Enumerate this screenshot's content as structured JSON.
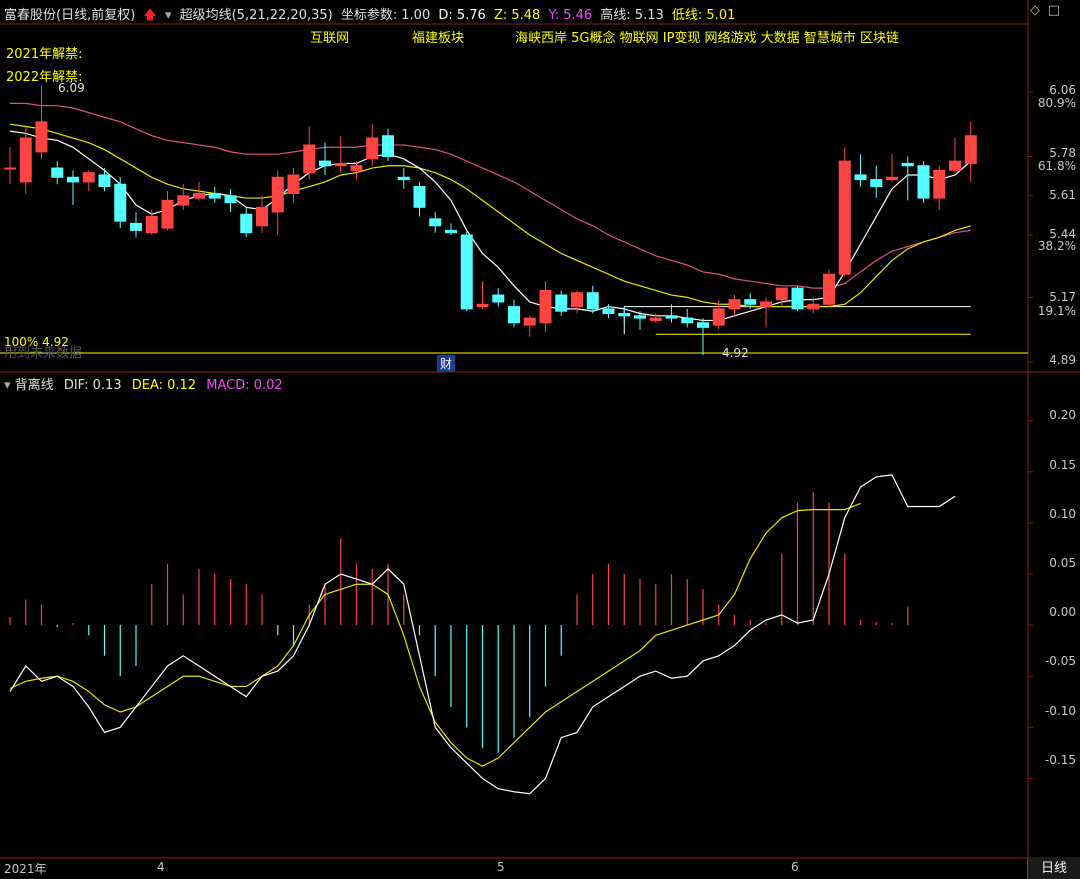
{
  "header": {
    "stock_name": "富春股份(日线,前复权)",
    "indicator_name": "超级均线(5,21,22,20,35)",
    "coord_label": "坐标参数:",
    "coord_value": "1.00",
    "d_text": "D: 5.76",
    "z_text": "Z: 5.48",
    "y_text": "Y: 5.46",
    "high_text": "高线: 5.13",
    "low_text": "低线: 5.01",
    "colors": {
      "d": "#ffffff",
      "z": "#ffff00",
      "y": "#ff44ff",
      "hl": "#ffff00"
    }
  },
  "concepts": {
    "c1": "互联网",
    "c2": "福建板块",
    "c3": "海峡西岸 5G概念 物联网 IP变现 网络游戏 大数据 智慧城市 区块链"
  },
  "unlock": {
    "u2021": "2021年解禁:",
    "u2022": "2022年解禁:"
  },
  "annotations": {
    "max_price": "6.09",
    "min_price": "4.92",
    "pct_label": "100% 4.92",
    "ghost_label": "用到未来数据",
    "finance_tag": "财"
  },
  "price_axis": {
    "ticks": [
      "6.06",
      "80.9%",
      "5.78",
      "61.8%",
      "5.61",
      "5.44",
      "38.2%",
      "5.17",
      "19.1%",
      "4.89"
    ]
  },
  "macd_header": {
    "name": "背离线",
    "dif": "DIF: 0.13",
    "dea": "DEA: 0.12",
    "macd": "MACD: 0.02"
  },
  "macd_axis": {
    "ticks": [
      "0.20",
      "0.15",
      "0.10",
      "0.05",
      "0.00",
      "-0.05",
      "-0.10",
      "-0.15"
    ]
  },
  "x_axis": {
    "labels": [
      "2021年",
      "4",
      "5",
      "6"
    ]
  },
  "period_button": "日线",
  "icons": [
    "arrow-up-icon",
    "diamond-icon",
    "window-icon",
    "collapse-icon"
  ],
  "chart_data": [
    {
      "type": "candlestick",
      "title": "富春股份(日线,前复权)",
      "ylim": [
        4.89,
        6.12
      ],
      "candles": [
        {
          "o": 5.73,
          "h": 5.82,
          "l": 5.66,
          "c": 5.73
        },
        {
          "o": 5.67,
          "h": 5.91,
          "l": 5.62,
          "c": 5.86
        },
        {
          "o": 5.8,
          "h": 6.09,
          "l": 5.77,
          "c": 5.93
        },
        {
          "o": 5.73,
          "h": 5.76,
          "l": 5.66,
          "c": 5.69
        },
        {
          "o": 5.69,
          "h": 5.72,
          "l": 5.57,
          "c": 5.67
        },
        {
          "o": 5.67,
          "h": 5.72,
          "l": 5.63,
          "c": 5.71
        },
        {
          "o": 5.7,
          "h": 5.73,
          "l": 5.63,
          "c": 5.65
        },
        {
          "o": 5.66,
          "h": 5.69,
          "l": 5.47,
          "c": 5.5
        },
        {
          "o": 5.49,
          "h": 5.54,
          "l": 5.43,
          "c": 5.46
        },
        {
          "o": 5.45,
          "h": 5.55,
          "l": 5.44,
          "c": 5.52
        },
        {
          "o": 5.47,
          "h": 5.63,
          "l": 5.46,
          "c": 5.59
        },
        {
          "o": 5.57,
          "h": 5.66,
          "l": 5.55,
          "c": 5.61
        },
        {
          "o": 5.6,
          "h": 5.67,
          "l": 5.59,
          "c": 5.62
        },
        {
          "o": 5.62,
          "h": 5.65,
          "l": 5.58,
          "c": 5.6
        },
        {
          "o": 5.61,
          "h": 5.64,
          "l": 5.54,
          "c": 5.58
        },
        {
          "o": 5.53,
          "h": 5.56,
          "l": 5.43,
          "c": 5.45
        },
        {
          "o": 5.48,
          "h": 5.61,
          "l": 5.45,
          "c": 5.56
        },
        {
          "o": 5.54,
          "h": 5.72,
          "l": 5.44,
          "c": 5.69
        },
        {
          "o": 5.62,
          "h": 5.73,
          "l": 5.58,
          "c": 5.7
        },
        {
          "o": 5.71,
          "h": 5.91,
          "l": 5.68,
          "c": 5.83
        },
        {
          "o": 5.76,
          "h": 5.84,
          "l": 5.7,
          "c": 5.74
        },
        {
          "o": 5.74,
          "h": 5.87,
          "l": 5.71,
          "c": 5.75
        },
        {
          "o": 5.72,
          "h": 5.76,
          "l": 5.68,
          "c": 5.74
        },
        {
          "o": 5.77,
          "h": 5.92,
          "l": 5.74,
          "c": 5.86
        },
        {
          "o": 5.87,
          "h": 5.9,
          "l": 5.76,
          "c": 5.78
        },
        {
          "o": 5.69,
          "h": 5.73,
          "l": 5.64,
          "c": 5.68
        },
        {
          "o": 5.65,
          "h": 5.67,
          "l": 5.52,
          "c": 5.56
        },
        {
          "o": 5.51,
          "h": 5.54,
          "l": 5.45,
          "c": 5.48
        },
        {
          "o": 5.46,
          "h": 5.49,
          "l": 5.44,
          "c": 5.45
        },
        {
          "o": 5.44,
          "h": 5.46,
          "l": 5.11,
          "c": 5.12
        },
        {
          "o": 5.13,
          "h": 5.24,
          "l": 5.12,
          "c": 5.14
        },
        {
          "o": 5.18,
          "h": 5.21,
          "l": 5.13,
          "c": 5.15
        },
        {
          "o": 5.13,
          "h": 5.16,
          "l": 5.04,
          "c": 5.06
        },
        {
          "o": 5.05,
          "h": 5.09,
          "l": 5.0,
          "c": 5.08
        },
        {
          "o": 5.06,
          "h": 5.24,
          "l": 5.02,
          "c": 5.2
        },
        {
          "o": 5.18,
          "h": 5.2,
          "l": 5.09,
          "c": 5.11
        },
        {
          "o": 5.13,
          "h": 5.2,
          "l": 5.1,
          "c": 5.19
        },
        {
          "o": 5.19,
          "h": 5.22,
          "l": 5.1,
          "c": 5.12
        },
        {
          "o": 5.12,
          "h": 5.14,
          "l": 5.08,
          "c": 5.1
        },
        {
          "o": 5.1,
          "h": 5.13,
          "l": 5.06,
          "c": 5.09
        },
        {
          "o": 5.09,
          "h": 5.11,
          "l": 5.03,
          "c": 5.08
        },
        {
          "o": 5.07,
          "h": 5.1,
          "l": 5.06,
          "c": 5.08
        },
        {
          "o": 5.09,
          "h": 5.14,
          "l": 5.06,
          "c": 5.08
        },
        {
          "o": 5.08,
          "h": 5.12,
          "l": 5.04,
          "c": 5.06
        },
        {
          "o": 5.06,
          "h": 5.08,
          "l": 4.92,
          "c": 5.04
        },
        {
          "o": 5.05,
          "h": 5.16,
          "l": 5.03,
          "c": 5.12
        },
        {
          "o": 5.12,
          "h": 5.18,
          "l": 5.09,
          "c": 5.16
        },
        {
          "o": 5.16,
          "h": 5.19,
          "l": 5.12,
          "c": 5.14
        },
        {
          "o": 5.13,
          "h": 5.17,
          "l": 5.04,
          "c": 5.15
        },
        {
          "o": 5.16,
          "h": 5.21,
          "l": 5.13,
          "c": 5.21
        },
        {
          "o": 5.21,
          "h": 5.22,
          "l": 5.11,
          "c": 5.12
        },
        {
          "o": 5.12,
          "h": 5.17,
          "l": 5.1,
          "c": 5.14
        },
        {
          "o": 5.14,
          "h": 5.29,
          "l": 5.13,
          "c": 5.27
        },
        {
          "o": 5.27,
          "h": 5.82,
          "l": 5.26,
          "c": 5.76
        },
        {
          "o": 5.7,
          "h": 5.79,
          "l": 5.65,
          "c": 5.68
        },
        {
          "o": 5.68,
          "h": 5.74,
          "l": 5.6,
          "c": 5.65
        },
        {
          "o": 5.68,
          "h": 5.79,
          "l": 5.67,
          "c": 5.69
        },
        {
          "o": 5.75,
          "h": 5.78,
          "l": 5.59,
          "c": 5.74
        },
        {
          "o": 5.74,
          "h": 5.76,
          "l": 5.58,
          "c": 5.6
        },
        {
          "o": 5.6,
          "h": 5.74,
          "l": 5.55,
          "c": 5.72
        },
        {
          "o": 5.72,
          "h": 5.86,
          "l": 5.71,
          "c": 5.76
        },
        {
          "o": 5.75,
          "h": 5.93,
          "l": 5.67,
          "c": 5.87
        }
      ],
      "ma_white": [
        5.89,
        5.88,
        5.86,
        5.85,
        5.82,
        5.77,
        5.72,
        5.66,
        5.57,
        5.53,
        5.55,
        5.59,
        5.61,
        5.62,
        5.61,
        5.56,
        5.55,
        5.6,
        5.66,
        5.71,
        5.74,
        5.75,
        5.75,
        5.78,
        5.79,
        5.77,
        5.73,
        5.67,
        5.59,
        5.46,
        5.36,
        5.3,
        5.22,
        5.15,
        5.13,
        5.12,
        5.12,
        5.11,
        5.13,
        5.12,
        5.1,
        5.09,
        5.09,
        5.08,
        5.07,
        5.07,
        5.09,
        5.11,
        5.13,
        5.15,
        5.16,
        5.16,
        5.17,
        5.28,
        5.4,
        5.52,
        5.64,
        5.7,
        5.7,
        5.68,
        5.7,
        5.76
      ],
      "ma_yellow": [
        5.92,
        5.91,
        5.9,
        5.88,
        5.86,
        5.84,
        5.81,
        5.77,
        5.73,
        5.69,
        5.66,
        5.64,
        5.63,
        5.62,
        5.61,
        5.6,
        5.6,
        5.61,
        5.63,
        5.65,
        5.67,
        5.7,
        5.71,
        5.73,
        5.74,
        5.74,
        5.73,
        5.71,
        5.68,
        5.64,
        5.59,
        5.54,
        5.49,
        5.44,
        5.4,
        5.36,
        5.33,
        5.3,
        5.27,
        5.24,
        5.22,
        5.2,
        5.18,
        5.17,
        5.15,
        5.14,
        5.14,
        5.13,
        5.13,
        5.13,
        5.13,
        5.13,
        5.13,
        5.14,
        5.19,
        5.26,
        5.33,
        5.38,
        5.41,
        5.43,
        5.46,
        5.48
      ],
      "ma_pink": [
        6.01,
        6.01,
        6.0,
        6.0,
        5.99,
        5.97,
        5.95,
        5.93,
        5.9,
        5.87,
        5.85,
        5.84,
        5.83,
        5.82,
        5.8,
        5.79,
        5.79,
        5.79,
        5.8,
        5.81,
        5.82,
        5.82,
        5.82,
        5.83,
        5.83,
        5.83,
        5.82,
        5.81,
        5.79,
        5.76,
        5.73,
        5.7,
        5.67,
        5.63,
        5.59,
        5.55,
        5.51,
        5.48,
        5.44,
        5.41,
        5.38,
        5.35,
        5.33,
        5.31,
        5.28,
        5.27,
        5.25,
        5.24,
        5.23,
        5.22,
        5.22,
        5.21,
        5.21,
        5.23,
        5.28,
        5.33,
        5.37,
        5.39,
        5.41,
        5.43,
        5.45,
        5.46
      ],
      "high_line": 5.13,
      "low_line": 5.01
    },
    {
      "type": "macd",
      "ylim": [
        -0.22,
        0.23
      ],
      "dif": [
        -0.065,
        -0.04,
        -0.055,
        -0.05,
        -0.06,
        -0.08,
        -0.105,
        -0.1,
        -0.08,
        -0.06,
        -0.04,
        -0.03,
        -0.04,
        -0.05,
        -0.06,
        -0.07,
        -0.05,
        -0.045,
        -0.03,
        0.0,
        0.04,
        0.05,
        0.045,
        0.04,
        0.055,
        0.04,
        -0.03,
        -0.1,
        -0.12,
        -0.135,
        -0.15,
        -0.16,
        -0.163,
        -0.165,
        -0.15,
        -0.11,
        -0.105,
        -0.08,
        -0.07,
        -0.06,
        -0.05,
        -0.045,
        -0.052,
        -0.05,
        -0.035,
        -0.03,
        -0.02,
        -0.005,
        0.005,
        0.01,
        0.002,
        0.005,
        0.05,
        0.105,
        0.135,
        0.145,
        0.147,
        0.116,
        0.116,
        0.116,
        0.126
      ],
      "dea": [
        -0.062,
        -0.055,
        -0.052,
        -0.05,
        -0.055,
        -0.065,
        -0.078,
        -0.085,
        -0.08,
        -0.07,
        -0.06,
        -0.05,
        -0.05,
        -0.055,
        -0.06,
        -0.06,
        -0.05,
        -0.04,
        -0.02,
        0.01,
        0.03,
        0.035,
        0.04,
        0.04,
        0.03,
        -0.01,
        -0.06,
        -0.095,
        -0.115,
        -0.13,
        -0.138,
        -0.13,
        -0.115,
        -0.1,
        -0.085,
        -0.075,
        -0.065,
        -0.055,
        -0.045,
        -0.035,
        -0.025,
        -0.01,
        -0.005,
        0.0,
        0.005,
        0.01,
        0.03,
        0.065,
        0.09,
        0.105,
        0.112,
        0.113,
        0.113,
        0.113,
        0.119
      ],
      "macd_bars": [
        0.008,
        0.025,
        0.02,
        -0.002,
        0.002,
        -0.01,
        -0.03,
        -0.05,
        -0.04,
        0.04,
        0.06,
        0.03,
        0.055,
        0.05,
        0.045,
        0.04,
        0.03,
        -0.01,
        -0.02,
        0.02,
        0.04,
        0.085,
        0.06,
        0.055,
        0.06,
        0.03,
        -0.01,
        -0.05,
        -0.08,
        -0.1,
        -0.12,
        -0.125,
        -0.11,
        -0.09,
        -0.06,
        -0.03,
        0.03,
        0.05,
        0.06,
        0.05,
        0.045,
        0.04,
        0.05,
        0.045,
        0.035,
        0.02,
        0.01,
        0.005,
        0.002,
        0.07,
        0.12,
        0.13,
        0.12,
        0.07,
        0.005,
        0.003,
        0.002,
        0.018
      ]
    }
  ]
}
